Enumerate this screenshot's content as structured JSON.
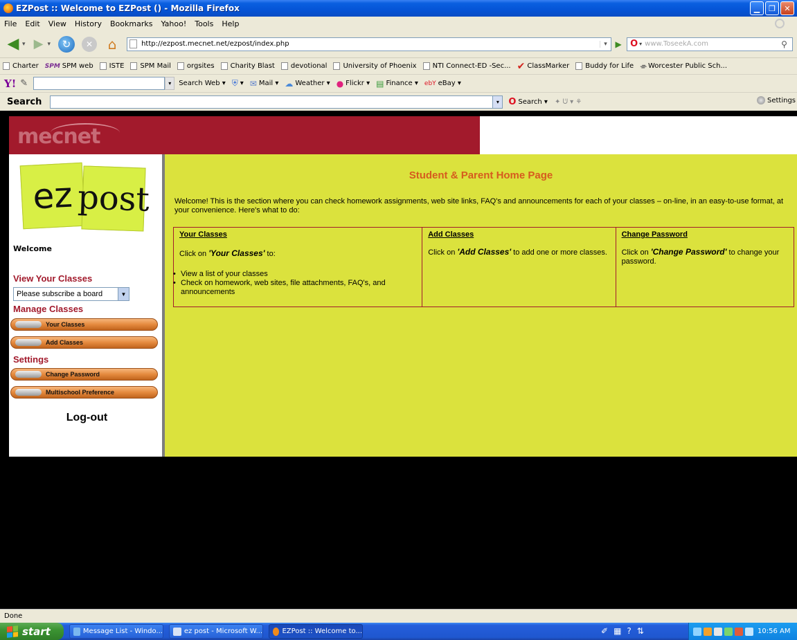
{
  "window": {
    "title": "EZPost :: Welcome to EZPost () - Mozilla Firefox"
  },
  "menu": [
    "File",
    "Edit",
    "View",
    "History",
    "Bookmarks",
    "Yahoo!",
    "Tools",
    "Help"
  ],
  "nav": {
    "url": "http://ezpost.mecnet.net/ezpost/index.php",
    "search_placeholder": "www.ToseekA.com"
  },
  "bookmarks": [
    "Charter",
    "SPM web",
    "ISTE",
    "SPM Mail",
    "orgsites",
    "Charity Blast",
    "devotional",
    "University of Phoenix",
    "NTI Connect-ED -Sec...",
    "ClassMarker",
    "Buddy for Life",
    "Worcester Public Sch..."
  ],
  "yahoo_toolbar": {
    "search_web": "Search Web",
    "mail": "Mail",
    "weather": "Weather",
    "flickr": "Flickr",
    "finance": "Finance",
    "ebay": "eBay"
  },
  "search_toolbar": {
    "label": "Search",
    "search_button": "Search",
    "settings": "Settings"
  },
  "page": {
    "banner_logo": "mecnet",
    "ez_logo_left": "ez",
    "ez_logo_right": "post",
    "welcome": "Welcome",
    "view_classes_heading": "View Your Classes",
    "board_select_value": "Please subscribe a board",
    "manage_classes_heading": "Manage Classes",
    "your_classes_btn": "Your Classes",
    "add_classes_btn": "Add Classes",
    "settings_heading": "Settings",
    "change_password_btn": "Change Password",
    "multischool_btn": "Multischool Preference",
    "logout": "Log-out",
    "main_title": "Student & Parent Home Page",
    "intro": "Welcome! This is the section where you can check homework assignments, web site links, FAQ's and announcements for each of your classes – on-line, in an easy-to-use format, at your convenience. Here's what to do:",
    "steps": [
      {
        "heading": "Your Classes",
        "pre": "Click on ",
        "em": "'Your Classes'",
        "post": " to:",
        "bullets": [
          "View a list of your classes",
          "Check on homework, web sites, file attachments, FAQ's, and announcements"
        ]
      },
      {
        "heading": "Add Classes",
        "pre": "Click on ",
        "em": "'Add Classes'",
        "post": " to add one or more classes."
      },
      {
        "heading": "Change Password",
        "pre": "Click on ",
        "em": "'Change Password'",
        "post": " to change your password."
      }
    ]
  },
  "status": "Done",
  "taskbar": {
    "start": "start",
    "tasks": [
      "Message List - Windo...",
      "ez post - Microsoft W...",
      "EZPost :: Welcome to..."
    ],
    "clock": "10:56 AM"
  },
  "colors": {
    "banner": "#a21a2c",
    "main_bg": "#dbe23d",
    "title_orange": "#d65b1e",
    "heading_red": "#a21a2c"
  }
}
